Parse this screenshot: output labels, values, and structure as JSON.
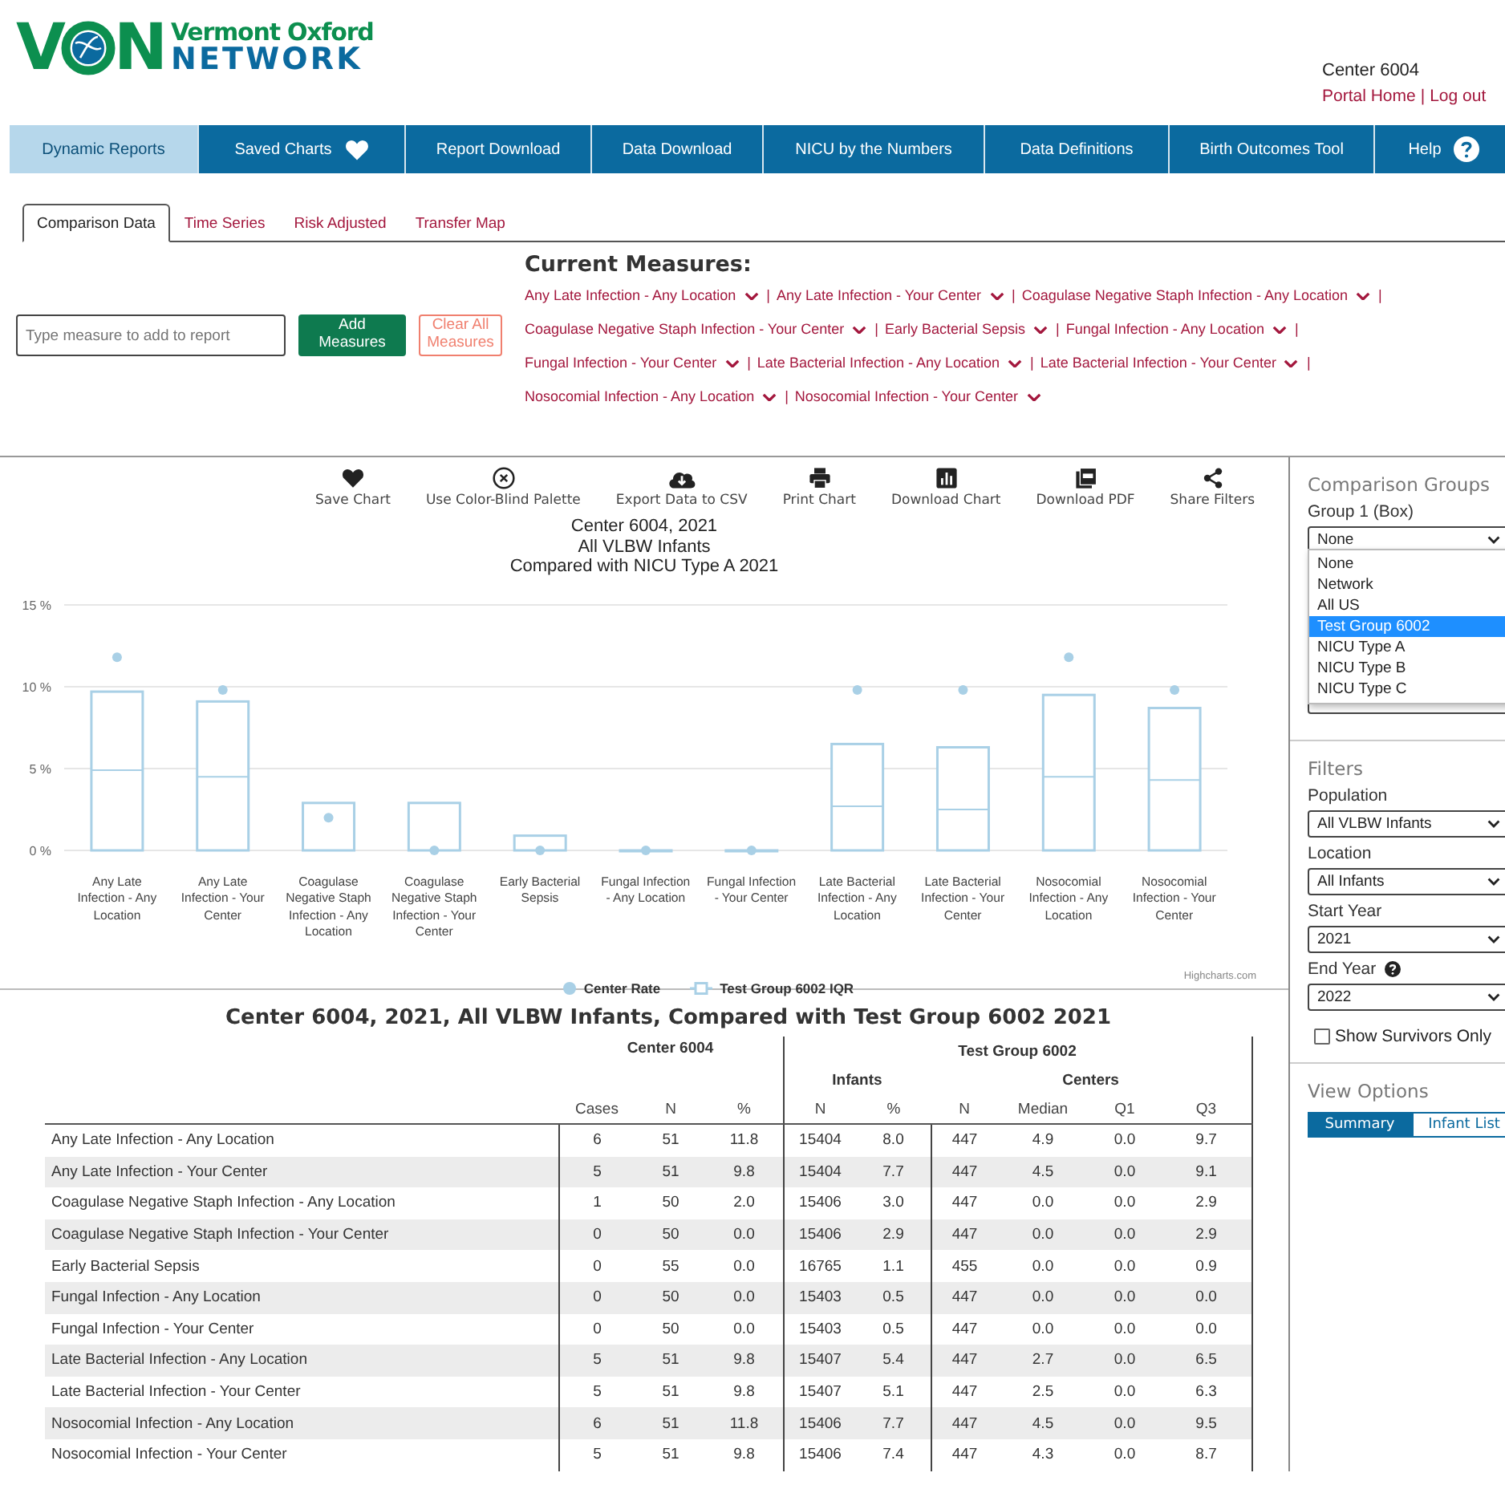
{
  "header": {
    "logo": {
      "mark_start": "V",
      "mark_end": "N",
      "name_top": "Vermont Oxford",
      "name_bottom": "NETWORK"
    },
    "center": "Center 6004",
    "link_separator": "|",
    "links": [
      {
        "label": "Portal Home"
      },
      {
        "label": "Log out"
      }
    ]
  },
  "nav": [
    {
      "label": "Dynamic Reports",
      "selected": true
    },
    {
      "label": "Saved Charts",
      "selected": false
    },
    {
      "label": "Report Download",
      "selected": false
    },
    {
      "label": "Data Download",
      "selected": false
    },
    {
      "label": "NICU by the Numbers",
      "selected": false
    },
    {
      "label": "Data Definitions",
      "selected": false
    },
    {
      "label": "Birth Outcomes Tool",
      "selected": false
    },
    {
      "label": "Help",
      "selected": false
    }
  ],
  "subtabs": [
    {
      "label": "Comparison Data",
      "selected": true
    },
    {
      "label": "Time Series",
      "selected": false
    },
    {
      "label": "Risk Adjusted",
      "selected": false
    },
    {
      "label": "Transfer Map",
      "selected": false
    }
  ],
  "measure_search": {
    "placeholder": "Type measure to add to report"
  },
  "buttons": [
    {
      "label": "Add Measures",
      "kind": "primary"
    },
    {
      "label": "Clear All Measures",
      "kind": "outline"
    }
  ],
  "current_measures": {
    "title": "Current Measures:",
    "separator": "|",
    "items": [
      "Any Late Infection - Any Location",
      "Any Late Infection - Your Center",
      "Coagulase Negative Staph Infection - Any Location",
      "Coagulase Negative Staph Infection - Your Center",
      "Early Bacterial Sepsis",
      "Fungal Infection - Any Location",
      "Fungal Infection - Your Center",
      "Late Bacterial Infection - Any Location",
      "Late Bacterial Infection - Your Center",
      "Nosocomial Infection - Any Location",
      "Nosocomial Infection - Your Center"
    ]
  },
  "chart_toolbar": [
    {
      "label": "Save Chart"
    },
    {
      "label": "Use Color-Blind Palette"
    },
    {
      "label": "Export Data to CSV"
    },
    {
      "label": "Print Chart"
    },
    {
      "label": "Download Chart"
    },
    {
      "label": "Download PDF"
    },
    {
      "label": "Share Filters"
    }
  ],
  "chart": {
    "title_lines": [
      "Center 6004, 2021",
      "All VLBW Infants",
      "Compared with NICU Type A 2021"
    ],
    "credit": "Highcharts.com",
    "chart_data": {
      "type": "bar",
      "legend": "bottom",
      "ylim": [
        0,
        15
      ],
      "yticks": [
        {
          "value": 0,
          "label": "0 %"
        },
        {
          "value": 5,
          "label": "5 %"
        },
        {
          "value": 10,
          "label": "10 %"
        },
        {
          "value": 15,
          "label": "15 %"
        }
      ],
      "categories": [
        "Any Late Infection - Any Location",
        "Any Late Infection - Your Center",
        "Coagulase Negative Staph Infection - Any Location",
        "Coagulase Negative Staph Infection - Your Center",
        "Early Bacterial Sepsis",
        "Fungal Infection - Any Location",
        "Fungal Infection - Your Center",
        "Late Bacterial Infection - Any Location",
        "Late Bacterial Infection - Your Center",
        "Nosocomial Infection - Any Location",
        "Nosocomial Infection - Your Center"
      ],
      "series": [
        {
          "name": "Center Rate",
          "type": "scatter",
          "color": "#a9d0e6",
          "values": [
            11.8,
            9.8,
            2.0,
            0.0,
            0.0,
            0.0,
            0.0,
            9.8,
            9.8,
            11.8,
            9.8
          ]
        },
        {
          "name": "Test Group 6002 IQR",
          "type": "bar",
          "color": "#a9d0e6",
          "values": [
            9.7,
            9.1,
            2.9,
            2.9,
            0.9,
            0.0,
            0.0,
            6.5,
            6.3,
            9.5,
            8.7
          ]
        }
      ]
    }
  },
  "table": {
    "title": "Center 6004, 2021, All VLBW Infants, Compared with Test Group 6002 2021",
    "group_left": "Center 6004",
    "group_right": "Test Group 6002",
    "subgroups": [
      "Infants",
      "Centers"
    ],
    "columns": [
      "Cases",
      "N",
      "%",
      "N",
      "%",
      "N",
      "Median",
      "Q1",
      "Q3"
    ],
    "rows": [
      {
        "name": "Any Late Infection - Any Location",
        "cells": [
          "6",
          "51",
          "11.8",
          "15404",
          "8.0",
          "447",
          "4.9",
          "0.0",
          "9.7"
        ]
      },
      {
        "name": "Any Late Infection - Your Center",
        "cells": [
          "5",
          "51",
          "9.8",
          "15404",
          "7.7",
          "447",
          "4.5",
          "0.0",
          "9.1"
        ]
      },
      {
        "name": "Coagulase Negative Staph Infection - Any Location",
        "cells": [
          "1",
          "50",
          "2.0",
          "15406",
          "3.0",
          "447",
          "0.0",
          "0.0",
          "2.9"
        ]
      },
      {
        "name": "Coagulase Negative Staph Infection - Your Center",
        "cells": [
          "0",
          "50",
          "0.0",
          "15406",
          "2.9",
          "447",
          "0.0",
          "0.0",
          "2.9"
        ]
      },
      {
        "name": "Early Bacterial Sepsis",
        "cells": [
          "0",
          "55",
          "0.0",
          "16765",
          "1.1",
          "455",
          "0.0",
          "0.0",
          "0.9"
        ]
      },
      {
        "name": "Fungal Infection - Any Location",
        "cells": [
          "0",
          "50",
          "0.0",
          "15403",
          "0.5",
          "447",
          "0.0",
          "0.0",
          "0.0"
        ]
      },
      {
        "name": "Fungal Infection - Your Center",
        "cells": [
          "0",
          "50",
          "0.0",
          "15403",
          "0.5",
          "447",
          "0.0",
          "0.0",
          "0.0"
        ]
      },
      {
        "name": "Late Bacterial Infection - Any Location",
        "cells": [
          "5",
          "51",
          "9.8",
          "15407",
          "5.4",
          "447",
          "2.7",
          "0.0",
          "6.5"
        ]
      },
      {
        "name": "Late Bacterial Infection - Your Center",
        "cells": [
          "5",
          "51",
          "9.8",
          "15407",
          "5.1",
          "447",
          "2.5",
          "0.0",
          "6.3"
        ]
      },
      {
        "name": "Nosocomial Infection - Any Location",
        "cells": [
          "6",
          "51",
          "11.8",
          "15406",
          "7.7",
          "447",
          "4.5",
          "0.0",
          "9.5"
        ]
      },
      {
        "name": "Nosocomial Infection - Your Center",
        "cells": [
          "5",
          "51",
          "9.8",
          "15406",
          "7.4",
          "447",
          "4.3",
          "0.0",
          "8.7"
        ]
      }
    ]
  },
  "sidebar": {
    "comparison": {
      "title": "Comparison Groups",
      "label": "Group 1 (Box)",
      "value": "None",
      "open": true,
      "options": [
        {
          "label": "None",
          "highlighted": false
        },
        {
          "label": "Network",
          "highlighted": false
        },
        {
          "label": "All US",
          "highlighted": false
        },
        {
          "label": "Test Group 6002",
          "highlighted": true
        },
        {
          "label": "NICU Type A",
          "highlighted": false
        },
        {
          "label": "NICU Type B",
          "highlighted": false
        },
        {
          "label": "NICU Type C",
          "highlighted": false
        }
      ]
    },
    "filters_title": "Filters",
    "filters": [
      {
        "label": "Population",
        "value": "All VLBW Infants",
        "help": false
      },
      {
        "label": "Location",
        "value": "All Infants",
        "help": false
      },
      {
        "label": "Start Year",
        "value": "2021",
        "help": false
      },
      {
        "label": "End Year",
        "value": "2022",
        "help": true
      }
    ],
    "survivors": {
      "label": "Show Survivors Only",
      "checked": false
    },
    "view_title": "View Options",
    "view_options": [
      {
        "label": "Summary",
        "selected": true
      },
      {
        "label": "Infant List",
        "selected": false
      }
    ]
  }
}
